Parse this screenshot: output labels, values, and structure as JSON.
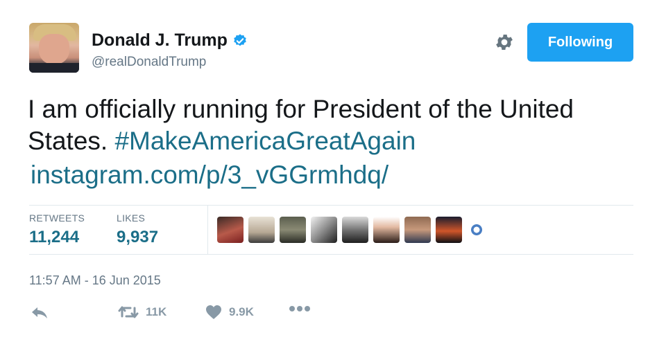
{
  "author": {
    "display_name": "Donald J. Trump",
    "handle": "@realDonaldTrump",
    "verified": true
  },
  "header": {
    "follow_button_label": "Following",
    "settings_icon": "gear-icon"
  },
  "tweet": {
    "text_prefix": "I am officially running for President of the United States.",
    "hashtag": "#MakeAmericaGreatAgain",
    "link": "instagram.com/p/3_vGGrmhdq/"
  },
  "stats": {
    "retweets_label": "RETWEETS",
    "retweets_value": "11,244",
    "likes_label": "LIKES",
    "likes_value": "9,937"
  },
  "timestamp": "11:57 AM - 16 Jun 2015",
  "actions": {
    "reply_icon": "reply-icon",
    "retweet_count": "11K",
    "like_count": "9.9K",
    "more_icon": "more-icon"
  },
  "colors": {
    "accent": "#1da1f2",
    "link": "#1b6e88",
    "secondary_text": "#657786",
    "divider": "#e1e8ed"
  }
}
